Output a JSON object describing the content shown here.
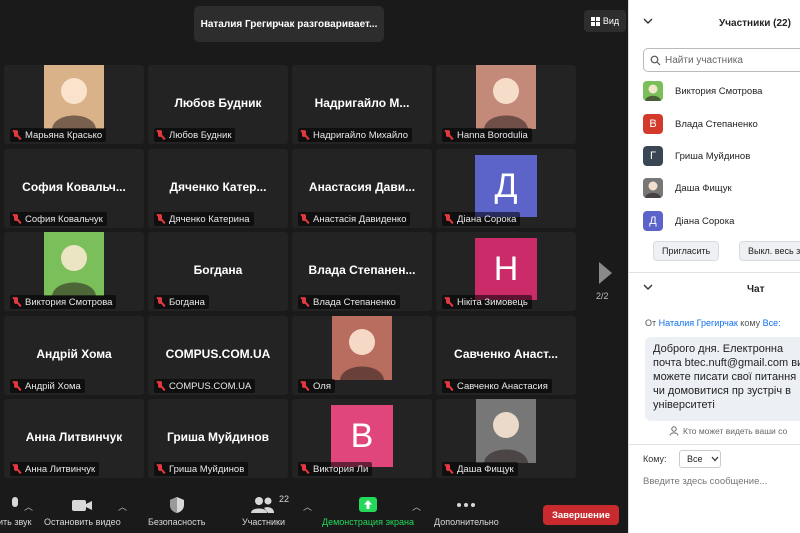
{
  "meeting": {
    "speaking_banner": "Наталия Грегирчак разговаривает...",
    "view_label": "Вид",
    "page_indicator": "2/2"
  },
  "tiles": [
    {
      "label": "Марьяна Красько",
      "kind": "photo",
      "color": "#d9b28a"
    },
    {
      "label": "Любов Будник",
      "kind": "name",
      "center": "Любов Будник"
    },
    {
      "label": "Надригайло Михайло",
      "kind": "name",
      "center": "Надригайло  М..."
    },
    {
      "label": "Hanna Borodulia",
      "kind": "photo",
      "color": "#c38a7a"
    },
    {
      "label": "София Ковальчук",
      "kind": "name",
      "center": "София  Ковальч..."
    },
    {
      "label": "Дяченко Катерина",
      "kind": "name",
      "center": "Дяченко  Катер..."
    },
    {
      "label": "Анастасія Давиденко",
      "kind": "name",
      "center": "Анастасия  Дави..."
    },
    {
      "label": "Діана Сорока",
      "kind": "letter",
      "letter": "Д",
      "color": "#5c63c9"
    },
    {
      "label": "Виктория Смотрова",
      "kind": "photo",
      "color": "#7bbf5a"
    },
    {
      "label": "Богдана",
      "kind": "name",
      "center": "Богдана"
    },
    {
      "label": "Влада Степаненко",
      "kind": "name",
      "center": "Влада  Степанен..."
    },
    {
      "label": "Нікіта Зимовець",
      "kind": "letter",
      "letter": "Н",
      "color": "#cc2b6a"
    },
    {
      "label": "Андрій Хома",
      "kind": "name",
      "center": "Андрій  Хома"
    },
    {
      "label": "COMPUS.COM.UA",
      "kind": "name",
      "center": "COMPUS.COM.UA"
    },
    {
      "label": "Оля",
      "kind": "photo",
      "color": "#b86d5e"
    },
    {
      "label": "Савченко Анастасия",
      "kind": "name",
      "center": "Савченко  Анаст..."
    },
    {
      "label": "Анна Литвинчук",
      "kind": "name",
      "center": "Анна  Литвинчук"
    },
    {
      "label": "Гриша Муйдинов",
      "kind": "name",
      "center": "Гриша  Муйдинов"
    },
    {
      "label": "Виктория Ли",
      "kind": "letter",
      "letter": "В",
      "color": "#e0457b"
    },
    {
      "label": "Даша Фищук",
      "kind": "photo",
      "color": "#777777"
    }
  ],
  "toolbar": {
    "audio": "ить звук",
    "video": "Остановить видео",
    "security": "Безопасность",
    "participants": "Участники",
    "participants_count": "22",
    "share": "Демонстрация экрана",
    "more": "Дополнительно",
    "end": "Завершение"
  },
  "panel": {
    "participants_title": "Участники (22)",
    "search_placeholder": "Найти участника",
    "participants": [
      {
        "name": "Виктория Смотрова",
        "avatar": "photo",
        "color": "#7bbf5a"
      },
      {
        "name": "Влада Степаненко",
        "avatar": "letter",
        "letter": "В",
        "color": "#d33a2c"
      },
      {
        "name": "Гриша Муйдинов",
        "avatar": "letter",
        "letter": "Г",
        "color": "#3a4654"
      },
      {
        "name": "Даша Фищук",
        "avatar": "photo",
        "color": "#777777"
      },
      {
        "name": "Діана Сорока",
        "avatar": "letter",
        "letter": "Д",
        "color": "#5c63c9"
      }
    ],
    "invite": "Пригласить",
    "mute_all": "Выкл. весь зв",
    "chat_title": "Чат",
    "chat_from_prefix": "От",
    "chat_from_name": "Наталия Грегирчак",
    "chat_to_word": "кому",
    "chat_to_all": "Все:",
    "chat_message": "Доброго дня. Електронна почта btec.nuft@gmail.com ви можете писати свої питання чи домовитися пр зустріч в університеті",
    "who_sees": "Кто может видеть ваши со",
    "to_label": "Кому:",
    "to_value": "Все",
    "input_placeholder": "Введите здесь сообщение..."
  }
}
